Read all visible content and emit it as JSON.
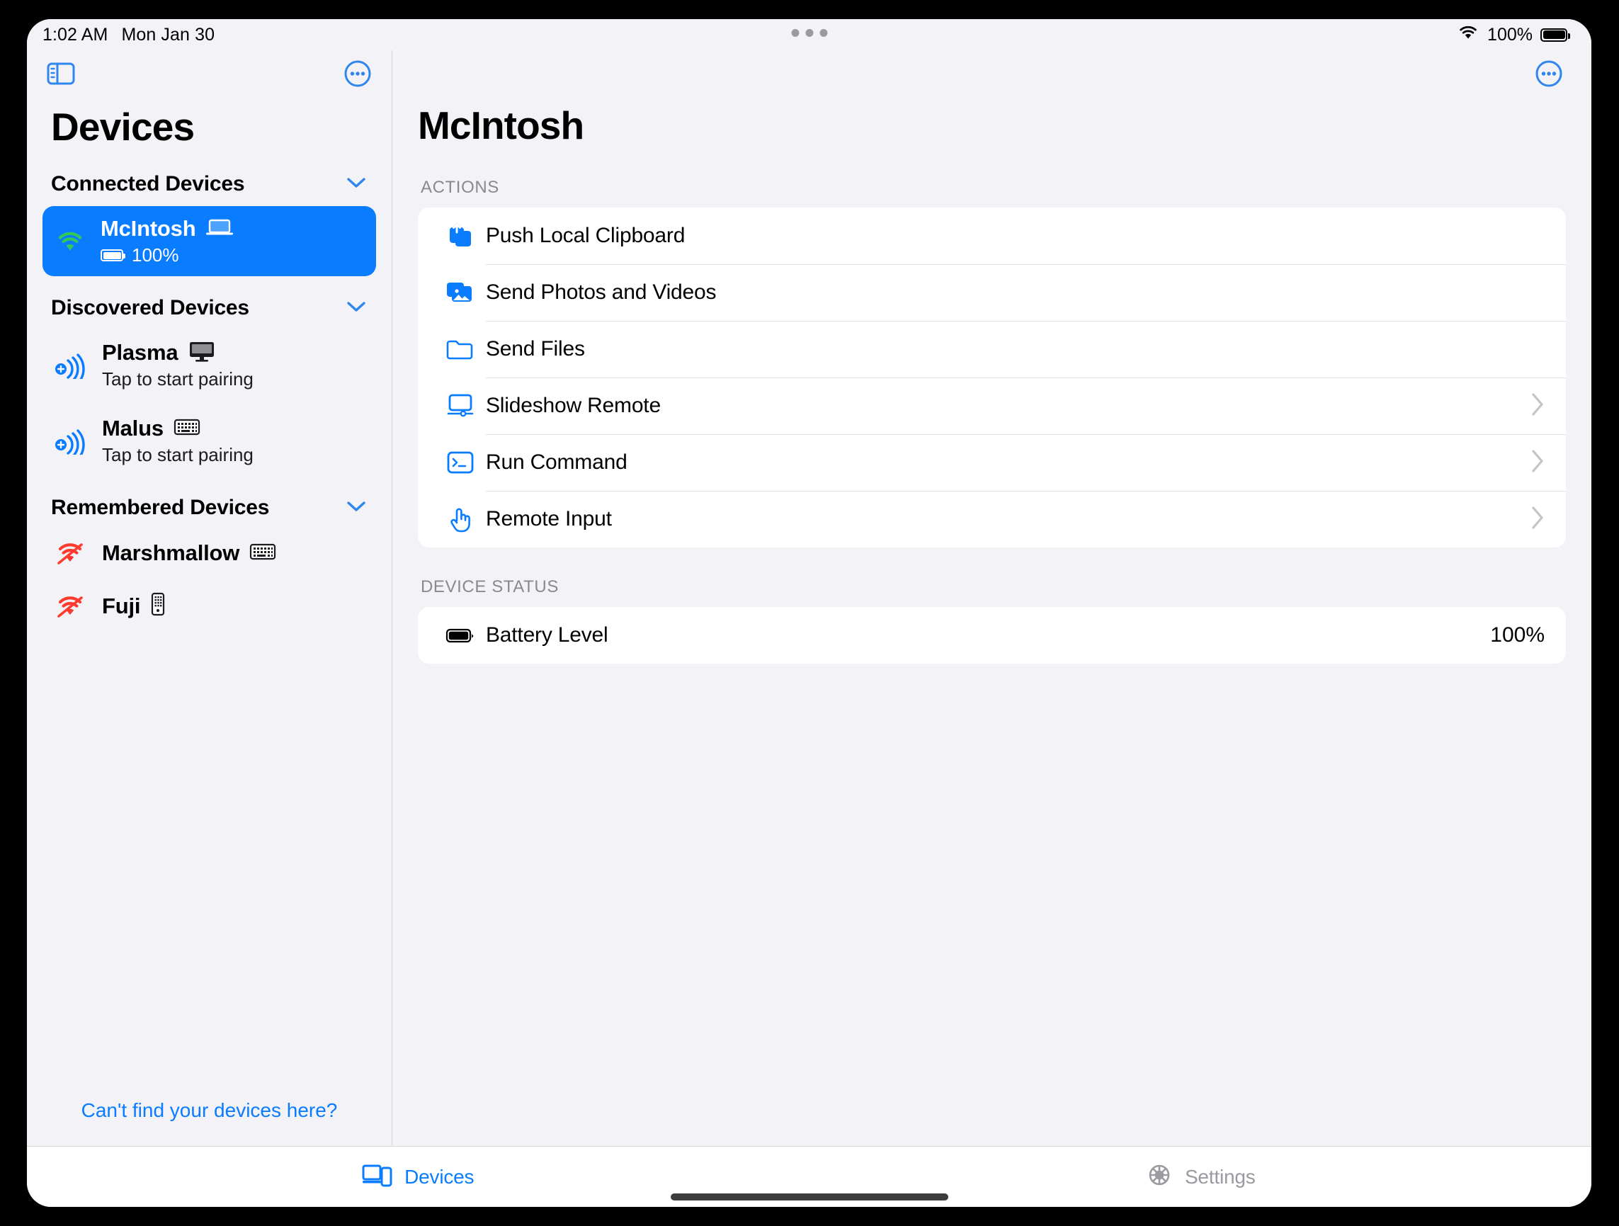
{
  "status_bar": {
    "time": "1:02 AM",
    "date": "Mon Jan 30",
    "battery_percent": "100%",
    "wifi_icon": "wifi-icon",
    "battery_icon": "battery-full-icon",
    "grabber_icon": "multitasking-grabber-icon"
  },
  "sidebar": {
    "toggle_icon": "sidebar-toggle-icon",
    "more_icon": "ellipsis-circle-icon",
    "title": "Devices",
    "sections": [
      {
        "label": "Connected Devices",
        "chevron_icon": "chevron-down-icon",
        "devices": [
          {
            "name": "McIntosh",
            "status_icon": "wifi-connected-icon",
            "type_icon": "laptop-icon",
            "battery": "100%",
            "selected": true
          }
        ]
      },
      {
        "label": "Discovered Devices",
        "chevron_icon": "chevron-down-icon",
        "devices": [
          {
            "name": "Plasma",
            "status_icon": "wifi-add-icon",
            "type_icon": "desktop-icon",
            "subtitle": "Tap to start pairing",
            "selected": false
          },
          {
            "name": "Malus",
            "status_icon": "wifi-add-icon",
            "type_icon": "keyboard-icon",
            "subtitle": "Tap to start pairing",
            "selected": false
          }
        ]
      },
      {
        "label": "Remembered Devices",
        "chevron_icon": "chevron-down-icon",
        "devices": [
          {
            "name": "Marshmallow",
            "status_icon": "wifi-slash-icon",
            "type_icon": "keyboard-icon",
            "subtitle": "",
            "selected": false
          },
          {
            "name": "Fuji",
            "status_icon": "wifi-slash-icon",
            "type_icon": "phone-icon",
            "subtitle": "",
            "selected": false
          }
        ]
      }
    ],
    "footer_link": "Can't find your devices here?"
  },
  "main": {
    "more_icon": "ellipsis-circle-icon",
    "title": "McIntosh",
    "actions_label": "ACTIONS",
    "actions": [
      {
        "label": "Push Local Clipboard",
        "icon": "share-clipboard-icon",
        "chevron": false
      },
      {
        "label": "Send Photos and Videos",
        "icon": "photos-icon",
        "chevron": false
      },
      {
        "label": "Send Files",
        "icon": "folder-icon",
        "chevron": false
      },
      {
        "label": "Slideshow Remote",
        "icon": "display-icon",
        "chevron": true
      },
      {
        "label": "Run Command",
        "icon": "terminal-icon",
        "chevron": true
      },
      {
        "label": "Remote Input",
        "icon": "hand-tap-icon",
        "chevron": true
      }
    ],
    "status_label": "DEVICE STATUS",
    "status_rows": [
      {
        "label": "Battery Level",
        "icon": "battery-full-icon",
        "value": "100%"
      }
    ]
  },
  "tab_bar": {
    "tabs": [
      {
        "label": "Devices",
        "icon": "devices-icon",
        "active": true
      },
      {
        "label": "Settings",
        "icon": "gear-icon",
        "active": false
      }
    ]
  },
  "colors": {
    "accent_blue": "#0a7cff",
    "connected_green": "#34c759",
    "disconnected_red": "#ff3b30",
    "surface": "#f2f2f7",
    "card": "#ffffff",
    "muted_text": "#8a8a8e"
  }
}
